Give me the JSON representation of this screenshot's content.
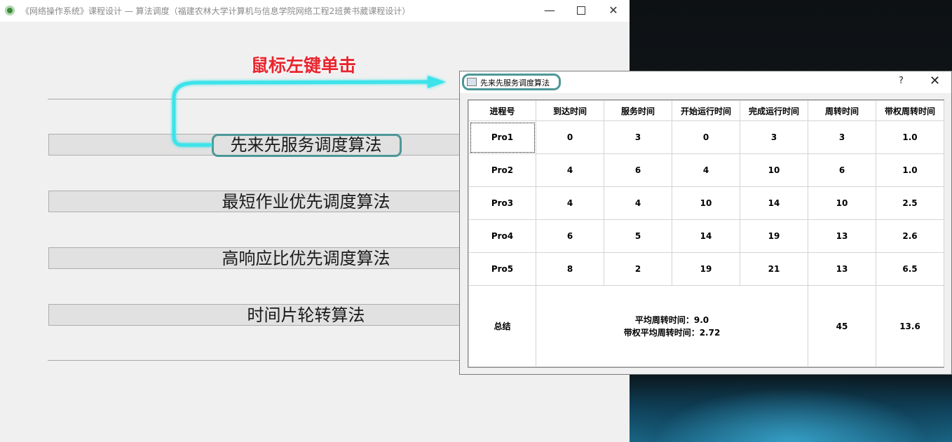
{
  "main_window": {
    "title": "《网络操作系统》课程设计 — 算法调度（福建农林大学计算机与信息学院网络工程2班黄书葳课程设计）",
    "buttons": {
      "fcfs": "先来先服务调度算法",
      "sjf": "最短作业优先调度算法",
      "hrrn": "高响应比优先调度算法",
      "rr": "时间片轮转算法"
    },
    "annotation": "鼠标左键单击"
  },
  "dialog": {
    "title": "先来先服务调度算法",
    "help": "?",
    "close": "✕",
    "table": {
      "headers": [
        "进程号",
        "到达时间",
        "服务时间",
        "开始运行时间",
        "完成运行时间",
        "周转时间",
        "带权周转时间"
      ],
      "rows": [
        [
          "Pro1",
          "0",
          "3",
          "0",
          "3",
          "3",
          "1.0"
        ],
        [
          "Pro2",
          "4",
          "6",
          "4",
          "10",
          "6",
          "1.0"
        ],
        [
          "Pro3",
          "4",
          "4",
          "10",
          "14",
          "10",
          "2.5"
        ],
        [
          "Pro4",
          "6",
          "5",
          "14",
          "19",
          "13",
          "2.6"
        ],
        [
          "Pro5",
          "8",
          "2",
          "19",
          "21",
          "13",
          "6.5"
        ]
      ],
      "summary": {
        "label": "总结",
        "avg_turnaround": "平均周转时间：9.0",
        "avg_weighted_turnaround": "带权平均周转时间：2.72",
        "total_turnaround": "45",
        "total_weighted": "13.6"
      }
    }
  },
  "colors": {
    "highlight": "#4d9797",
    "annotation": "#e8262f",
    "arrow": "#3ee3ea"
  }
}
